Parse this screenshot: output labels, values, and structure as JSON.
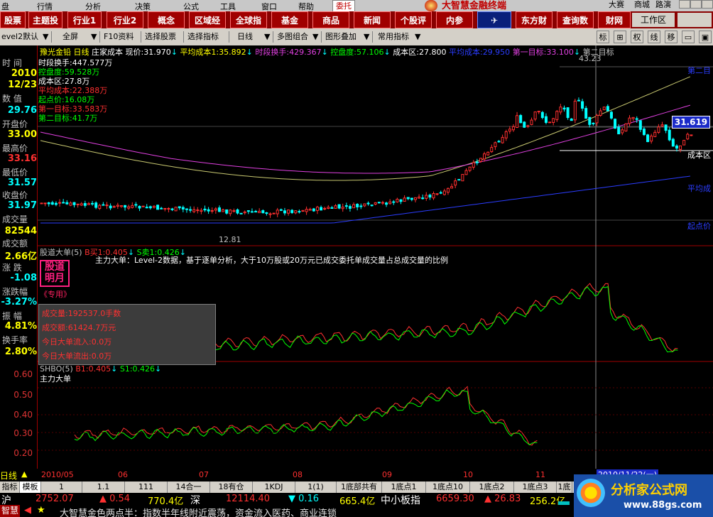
{
  "menu": {
    "items": [
      "盘",
      "行情",
      "分析",
      "决策",
      "公式",
      "工具",
      "窗口",
      "帮助"
    ],
    "right_tab": "委托",
    "app_title": "大智慧金融终端",
    "right_items": [
      "大赛",
      "商城",
      "路演"
    ]
  },
  "toolbar1": {
    "buttons": [
      "主题投",
      "行业1",
      "行业2",
      "概念",
      "区域经",
      "全球指",
      "基金",
      "商品",
      "新闻",
      "个股评",
      "内参",
      "东方财",
      "查询数",
      "财网"
    ],
    "left_btn": "股票",
    "workspace": "工作区"
  },
  "toolbar2": {
    "level": "evel2默认",
    "full": "全屏",
    "f10": "F10资料",
    "select_stock": "选择股票",
    "select_indicator": "选择指标",
    "period": "日线",
    "multi": "多图组合",
    "overlay": "图形叠加",
    "common": "常用指标",
    "right_btns": [
      "标",
      "⊞",
      "权",
      "线",
      "移",
      "▭",
      "▣"
    ]
  },
  "left_panel": {
    "time_label": "时 间",
    "year": "2010",
    "date": "12/23",
    "value_label": "数 值",
    "value": "29.76",
    "open_label": "开盘价",
    "open": "33.00",
    "high_label": "最高价",
    "high": "33.16",
    "low_label": "最低价",
    "low": "31.57",
    "close_label": "收盘价",
    "close": "31.97",
    "volume_label": "成交量",
    "volume": "82544",
    "amount_label": "成交额",
    "amount": "2.66亿",
    "change_label": "涨 跌",
    "change": "-1.08",
    "pct_label": "涨跌幅",
    "pct": "-3.27%",
    "amp_label": "振 幅",
    "amp": "4.81%",
    "turnover_label": "换手率",
    "turnover": "2.80%"
  },
  "main_chart": {
    "header": {
      "stock": "豫光金铅",
      "period": "日线",
      "indicator": "庄家成本",
      "price_label": "现价:",
      "price": "31.970",
      "avg_label": "平均成本1:",
      "avg": "35.892",
      "turnover_label": "时段换手:",
      "turnover": "429.367",
      "control_label": "控盘度:",
      "control": "57.106",
      "cost_label": "成本区:",
      "cost": "27.800",
      "avg2_label": "平均成本:",
      "avg2": "29.950",
      "target1_label": "第一目标:",
      "target1": "33.100",
      "target2_label": "第二目标"
    },
    "info_lines": [
      {
        "text": "时段换手:447.577万",
        "color": "#ffffff"
      },
      {
        "text": "控盘度:59.528万",
        "color": "#00ff00"
      },
      {
        "text": "成本区:27.8万",
        "color": "#ffffff"
      },
      {
        "text": "平均成本:22.388万",
        "color": "#ff3030"
      },
      {
        "text": "起点价:16.08万",
        "color": "#00ff00"
      },
      {
        "text": "第一目标:33.583万",
        "color": "#ff3030"
      },
      {
        "text": "第二目标:41.7万",
        "color": "#00ff00"
      }
    ],
    "peak_label": "43.23",
    "low_label": "12.81",
    "price_tag": "31.619",
    "right_labels": [
      "第二目",
      "成本区",
      "平均成",
      "起点价"
    ]
  },
  "sub_chart1": {
    "header": "股道大单(5)",
    "b_label": "B买1:",
    "b_value": "0.405",
    "s_label": "S卖1:",
    "s_value": "0.426",
    "desc": "主力大单：Level-2数据，基于逐单分析，大于10万股或20万元已成交委托单成交量占总成交量的比例",
    "logo_line1": "股道",
    "logo_line2": "明月",
    "exclusive": "《专用》",
    "info": [
      {
        "label": "成交量",
        "value": "192537.0手数"
      },
      {
        "label": "成交额",
        "value": "61424.7万元"
      },
      {
        "label": "今日大单流入",
        "value": "0.0万"
      },
      {
        "label": "今日大单流出",
        "value": "0.0万"
      }
    ]
  },
  "sub_chart2": {
    "header": "SHBO(5)",
    "b_label": "B1:",
    "b_value": "0.405",
    "s_label": "S1:",
    "s_value": "0.426",
    "name": "主力大单",
    "yticks": [
      "0.60",
      "0.50",
      "0.40",
      "0.30",
      "0.20"
    ]
  },
  "x_axis": {
    "period": "日线",
    "labels": [
      "2010/05",
      "06",
      "07",
      "08",
      "09",
      "10",
      "11"
    ],
    "cursor_date": "2010/11/22(一)"
  },
  "tabs": [
    "指标",
    "模板",
    "1",
    "1.1",
    "111",
    "14合一",
    "18有仓",
    "1KDJ",
    "1(1)",
    "1底部共有",
    "1底点1",
    "1底点10",
    "1底点2",
    "1底点3",
    "1底"
  ],
  "market": {
    "sh_label": "沪",
    "sh_index": "2752.07",
    "sh_change": "▲ 0.54",
    "sh_amount": "770.4亿",
    "sz_label": "深",
    "sz_index": "12114.40",
    "sz_change": "▼ 0.16",
    "sz_amount": "665.4亿",
    "zx_label": "中小板指",
    "zx_index": "6659.30",
    "zx_change": "▲ 26.83",
    "zx_amount": "256.2亿"
  },
  "ticker": {
    "brand": "智慧",
    "text": "大智慧金色两点半：指数半年线附近震荡，资金流入医药、商业连锁"
  },
  "watermark": {
    "title": "分析家公式网",
    "url": "www.88gs.com"
  },
  "colors": {
    "up": "#ff3030",
    "down": "#00ffff",
    "menu_red": "#a00000",
    "magenta": "#e040e0",
    "blue": "#2b3dff",
    "yellow_line": "#e8e8a0"
  }
}
